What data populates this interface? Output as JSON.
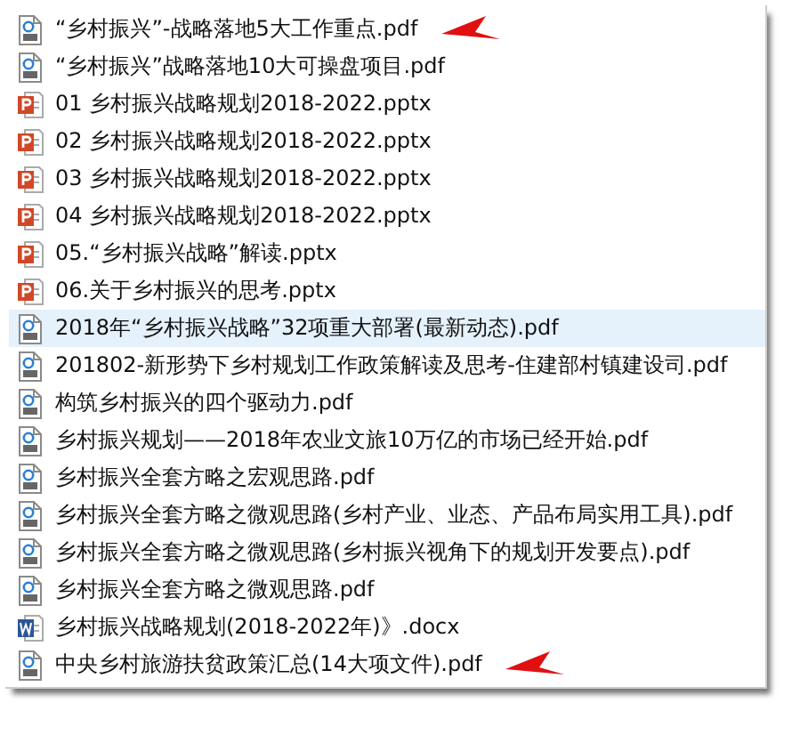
{
  "files": [
    {
      "name": "“乡村振兴”-战略落地5大工作重点.pdf",
      "kind": "pdf",
      "selected": false,
      "arrow": true
    },
    {
      "name": "“乡村振兴”战略落地10大可操盘项目.pdf",
      "kind": "pdf",
      "selected": false,
      "arrow": false
    },
    {
      "name": "01 乡村振兴战略规划2018-2022.pptx",
      "kind": "pptx",
      "selected": false,
      "arrow": false
    },
    {
      "name": "02 乡村振兴战略规划2018-2022.pptx",
      "kind": "pptx",
      "selected": false,
      "arrow": false
    },
    {
      "name": "03 乡村振兴战略规划2018-2022.pptx",
      "kind": "pptx",
      "selected": false,
      "arrow": false
    },
    {
      "name": "04 乡村振兴战略规划2018-2022.pptx",
      "kind": "pptx",
      "selected": false,
      "arrow": false
    },
    {
      "name": "05.“乡村振兴战略”解读.pptx",
      "kind": "pptx",
      "selected": false,
      "arrow": false
    },
    {
      "name": "06.关于乡村振兴的思考.pptx",
      "kind": "pptx",
      "selected": false,
      "arrow": false
    },
    {
      "name": "2018年“乡村振兴战略”32项重大部署(最新动态).pdf",
      "kind": "pdf",
      "selected": true,
      "arrow": false
    },
    {
      "name": "201802-新形势下乡村规划工作政策解读及思考-住建部村镇建设司.pdf",
      "kind": "pdf",
      "selected": false,
      "arrow": false
    },
    {
      "name": "构筑乡村振兴的四个驱动力.pdf",
      "kind": "pdf",
      "selected": false,
      "arrow": false
    },
    {
      "name": "乡村振兴规划——2018年农业文旅10万亿的市场已经开始.pdf",
      "kind": "pdf",
      "selected": false,
      "arrow": false
    },
    {
      "name": "乡村振兴全套方略之宏观思路.pdf",
      "kind": "pdf",
      "selected": false,
      "arrow": false
    },
    {
      "name": "乡村振兴全套方略之微观思路(乡村产业、业态、产品布局实用工具).pdf",
      "kind": "pdf",
      "selected": false,
      "arrow": false
    },
    {
      "name": "乡村振兴全套方略之微观思路(乡村振兴视角下的规划开发要点).pdf",
      "kind": "pdf",
      "selected": false,
      "arrow": false
    },
    {
      "name": "乡村振兴全套方略之微观思路.pdf",
      "kind": "pdf",
      "selected": false,
      "arrow": false
    },
    {
      "name": "乡村振兴战略规划(2018-2022年)》.docx",
      "kind": "docx",
      "selected": false,
      "arrow": false
    },
    {
      "name": "中央乡村旅游扶贫政策汇总(14大项文件).pdf",
      "kind": "pdf",
      "selected": false,
      "arrow": true
    }
  ]
}
